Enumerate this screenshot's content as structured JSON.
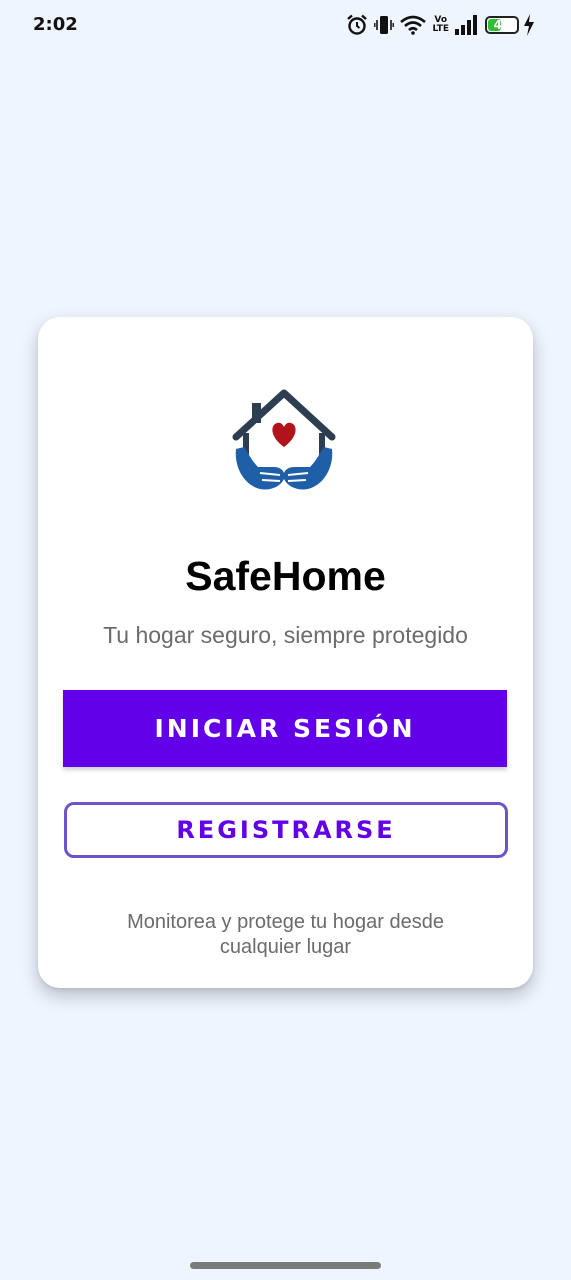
{
  "status_bar": {
    "time": "2:02",
    "network_top": "Vo",
    "network_bottom": "LTE",
    "battery_level": "45",
    "battery_fraction": 0.45
  },
  "icons": {
    "alarm": "alarm-icon",
    "vibrate": "vibrate-icon",
    "wifi": "wifi-icon",
    "signal": "signal-icon",
    "battery": "battery-icon",
    "charging": "charging-icon",
    "logo": "house-hands-heart-logo"
  },
  "app": {
    "title": "SafeHome",
    "subtitle": "Tu hogar seguro, siempre protegido",
    "login_label": "INICIAR SESIÓN",
    "register_label": "REGISTRARSE",
    "footer_text": "Monitorea y protege tu hogar desde cualquier lugar"
  },
  "colors": {
    "background": "#eef5ff",
    "primary": "#6200ea",
    "register_border": "#6e55c7",
    "logo_roof": "#2c3e50",
    "logo_hands": "#1f5fa8",
    "logo_heart": "#b0141a"
  }
}
